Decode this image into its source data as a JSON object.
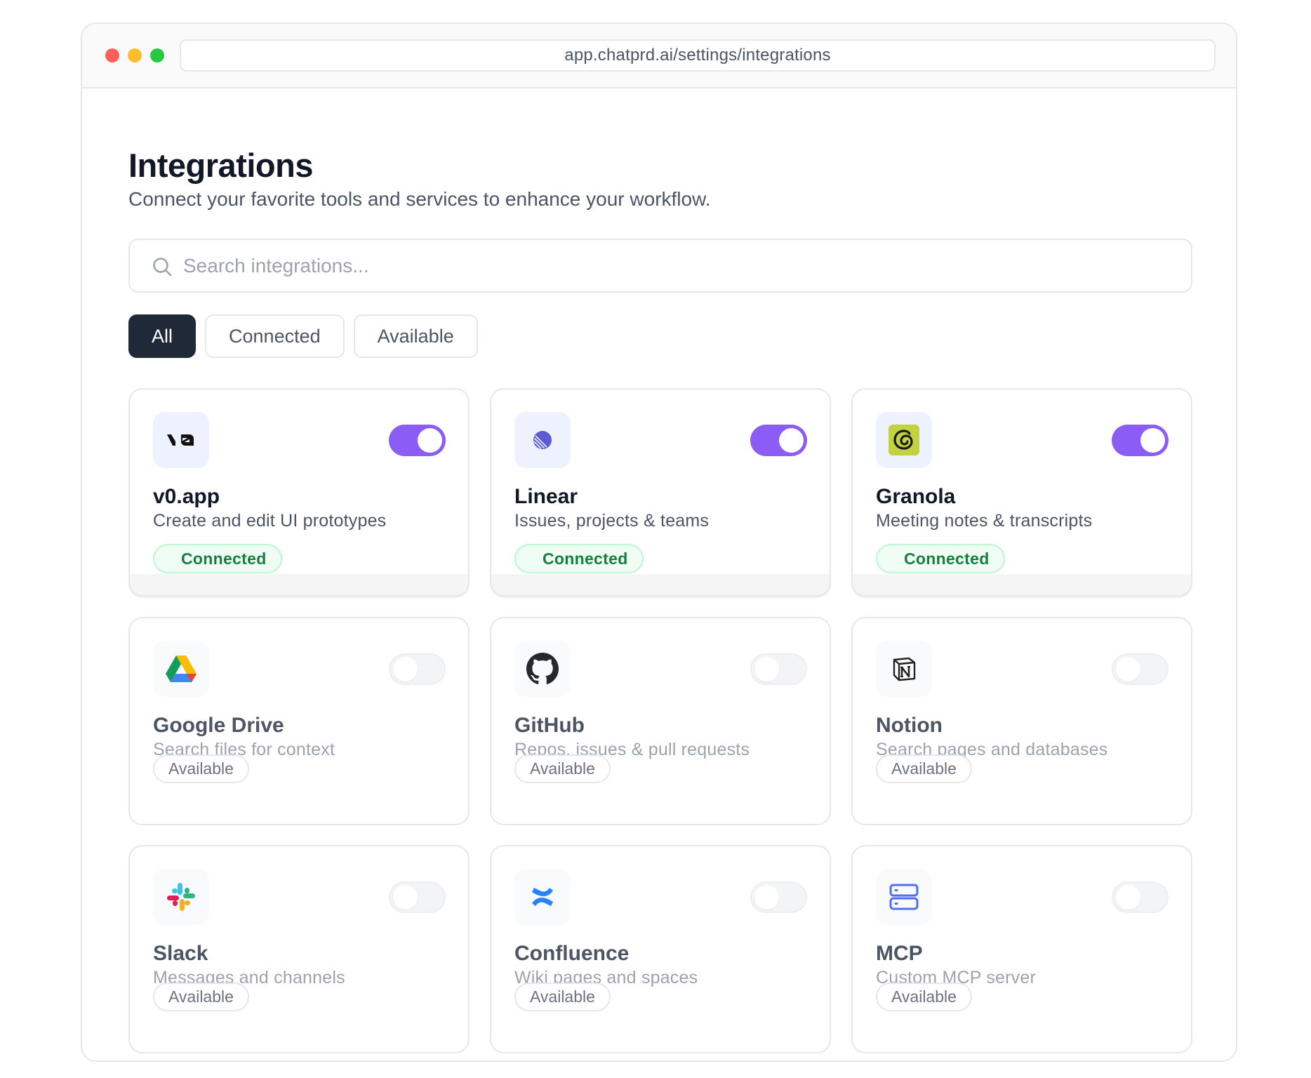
{
  "browser": {
    "url": "app.chatprd.ai/settings/integrations"
  },
  "page": {
    "title": "Integrations",
    "subtitle": "Connect your favorite tools and services to enhance your workflow."
  },
  "search": {
    "placeholder": "Search integrations..."
  },
  "filters": [
    {
      "label": "All",
      "active": true
    },
    {
      "label": "Connected",
      "active": false
    },
    {
      "label": "Available",
      "active": false
    }
  ],
  "integrations": [
    {
      "name": "v0.app",
      "description": "Create and edit UI prototypes",
      "status": "Connected",
      "enabled": true,
      "icon": "v0-logo-icon"
    },
    {
      "name": "Linear",
      "description": "Issues, projects & teams",
      "status": "Connected",
      "enabled": true,
      "icon": "linear-logo-icon"
    },
    {
      "name": "Granola",
      "description": "Meeting notes & transcripts",
      "status": "Connected",
      "enabled": true,
      "icon": "granola-logo-icon"
    },
    {
      "name": "Google Drive",
      "description": "Search files for context",
      "status": "Available",
      "enabled": false,
      "icon": "google-drive-logo-icon"
    },
    {
      "name": "GitHub",
      "description": "Repos, issues & pull requests",
      "status": "Available",
      "enabled": false,
      "icon": "github-logo-icon"
    },
    {
      "name": "Notion",
      "description": "Search pages and databases",
      "status": "Available",
      "enabled": false,
      "icon": "notion-logo-icon"
    },
    {
      "name": "Slack",
      "description": "Messages and channels",
      "status": "Available",
      "enabled": false,
      "icon": "slack-logo-icon"
    },
    {
      "name": "Confluence",
      "description": "Wiki pages and spaces",
      "status": "Available",
      "enabled": false,
      "icon": "confluence-logo-icon"
    },
    {
      "name": "MCP",
      "description": "Custom MCP server",
      "status": "Available",
      "enabled": false,
      "icon": "mcp-server-icon"
    }
  ],
  "colors": {
    "accent": "#8b5cf6",
    "active_filter": "#1f2937",
    "connected_text": "#15803d",
    "connected_bg": "#f0fdf4"
  }
}
